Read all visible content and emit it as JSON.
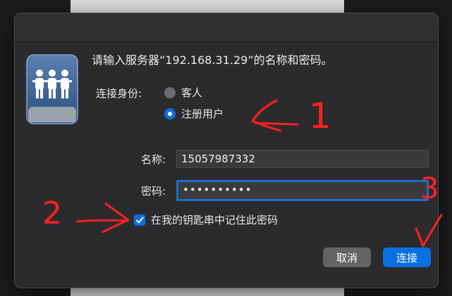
{
  "dialog": {
    "prompt": "请输入服务器“192.168.31.29”的名称和密码。",
    "connect_as_label": "连接身份:",
    "guest_label": "客人",
    "registered_label": "注册用户",
    "name_label": "名称:",
    "name_value": "15057987332",
    "password_label": "密码:",
    "password_value": "••••••••••",
    "remember_label": "在我的钥匙串中记住此密码",
    "cancel_label": "取消",
    "connect_label": "连接"
  },
  "annotations": {
    "mark_1": "1",
    "mark_2": "2",
    "mark_3": "3"
  },
  "colors": {
    "accent": "#0a6fe0",
    "annotation": "#ff2020"
  }
}
